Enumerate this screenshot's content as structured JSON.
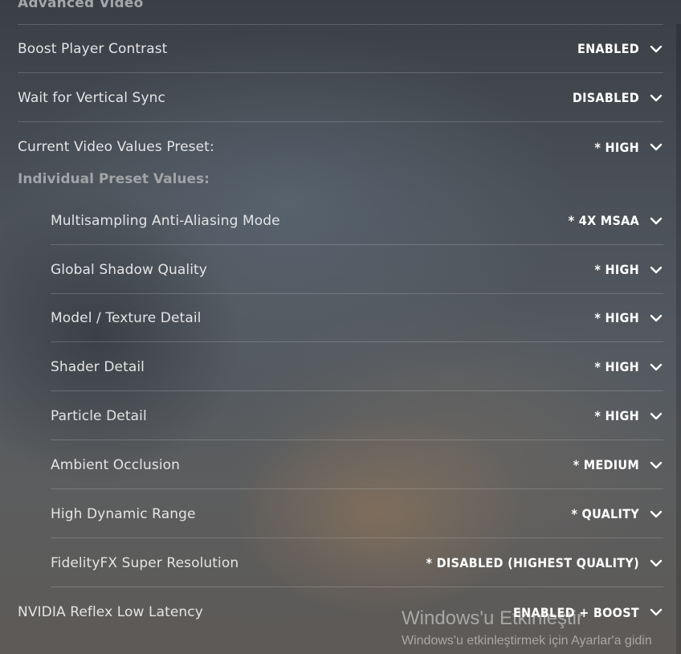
{
  "section": {
    "title": "Advanced Video"
  },
  "settings": [
    {
      "label": "Boost Player Contrast",
      "value": "ENABLED"
    },
    {
      "label": "Wait for Vertical Sync",
      "value": "DISABLED"
    },
    {
      "label": "Current Video Values Preset:",
      "value": "* HIGH"
    }
  ],
  "individual": {
    "header": "Individual Preset Values:",
    "items": [
      {
        "label": "Multisampling Anti-Aliasing Mode",
        "value": "* 4X MSAA"
      },
      {
        "label": "Global Shadow Quality",
        "value": "* HIGH"
      },
      {
        "label": "Model / Texture Detail",
        "value": "* HIGH"
      },
      {
        "label": "Shader Detail",
        "value": "* HIGH"
      },
      {
        "label": "Particle Detail",
        "value": "* HIGH"
      },
      {
        "label": "Ambient Occlusion",
        "value": "* MEDIUM"
      },
      {
        "label": "High Dynamic Range",
        "value": "* QUALITY"
      },
      {
        "label": "FidelityFX Super Resolution",
        "value": "* DISABLED (HIGHEST QUALITY)"
      }
    ]
  },
  "reflex": {
    "label": "NVIDIA Reflex Low Latency",
    "value": "ENABLED + BOOST"
  },
  "watermark": {
    "title": "Windows'u Etkinleştir",
    "subtitle": "Windows'u etkinleştirmek için Ayarlar'a gidin"
  },
  "icons": {
    "dropdown": "chevron-down-icon"
  }
}
